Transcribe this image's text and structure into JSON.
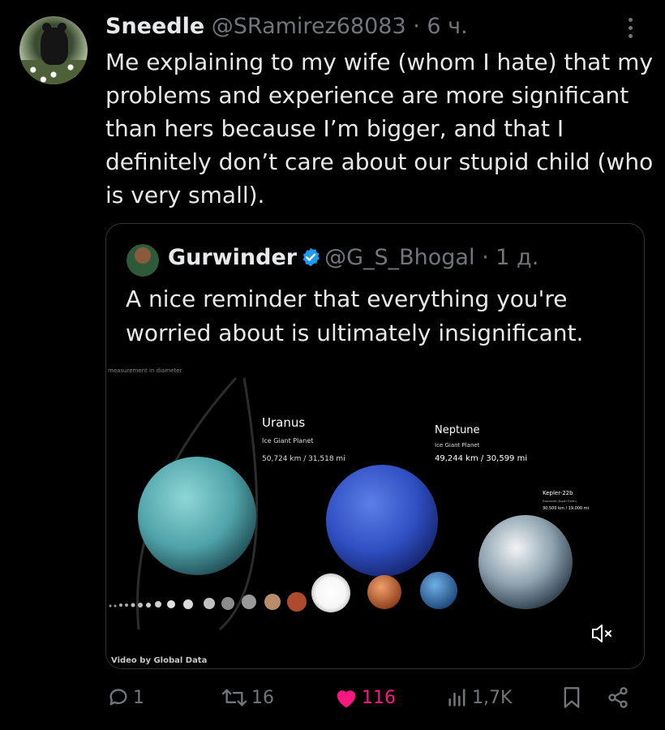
{
  "tweet": {
    "author_name": "Sneedle",
    "author_handle": "@SRamirez68083",
    "separator": "·",
    "time": "6 ч.",
    "text": "Me explaining to my wife (whom I hate) that my problems and experience are more significant than hers because I’m bigger, and that I definitely don’t care about our stupid child (who is very small)."
  },
  "quote": {
    "author_name": "Gurwinder",
    "author_handle": "@G_S_Bhogal",
    "separator": "·",
    "time": "1 д.",
    "text": "A nice reminder that everything you're worried about is ultimately insignificant.",
    "verified": true
  },
  "media": {
    "caption_top": "measurement in diameter",
    "credit": "Video by Global Data",
    "muted": true,
    "labels": {
      "uranus": {
        "name": "Uranus",
        "type": "Ice Giant Planet",
        "size": "50,724 km / 31,518 mi"
      },
      "neptune": {
        "name": "Neptune",
        "type": "Ice Giant Planet",
        "size": "49,244 km / 30,599 mi"
      },
      "kepler": {
        "name": "Kepler-22b",
        "type": "Exoplanet (Super Earth)",
        "size": "30,500 km / 19,000 mi"
      }
    }
  },
  "actions": {
    "replies": "1",
    "reposts": "16",
    "likes": "116",
    "views": "1,7K"
  },
  "colors": {
    "background": "#000000",
    "text": "#e7e9ea",
    "muted": "#71767b",
    "like": "#f91880",
    "verified": "#1d9bf0"
  },
  "icons": [
    "more-icon",
    "verified-icon",
    "reply-icon",
    "repost-icon",
    "like-icon",
    "views-icon",
    "bookmark-icon",
    "share-icon",
    "mute-icon"
  ]
}
